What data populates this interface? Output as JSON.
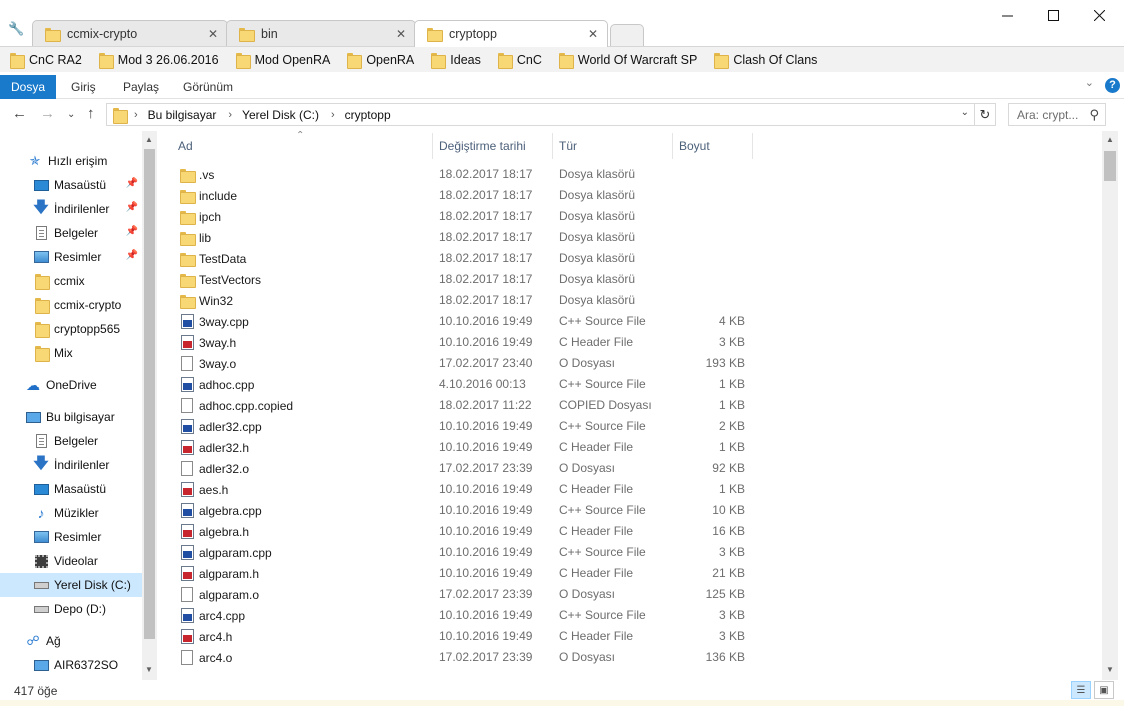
{
  "browser_tabs": [
    {
      "label": "ccmix-crypto",
      "active": false
    },
    {
      "label": "bin",
      "active": false
    },
    {
      "label": "cryptopp",
      "active": true
    }
  ],
  "bookmarks": [
    "CnC RA2",
    "Mod 3 26.06.2016",
    "Mod OpenRA",
    "OpenRA",
    "Ideas",
    "CnC",
    "World Of Warcraft SP",
    "Clash Of Clans"
  ],
  "ribbon": {
    "file": "Dosya",
    "tabs": [
      "Giriş",
      "Paylaş",
      "Görünüm"
    ]
  },
  "address": {
    "crumbs": [
      "Bu bilgisayar",
      "Yerel Disk (C:)",
      "cryptopp"
    ],
    "search_placeholder": "Ara: crypt..."
  },
  "sidebar": [
    {
      "label": "Hızlı erişim",
      "icon": "star-icon",
      "header": true
    },
    {
      "label": "Masaüstü",
      "icon": "desktop-icon",
      "pinned": true
    },
    {
      "label": "İndirilenler",
      "icon": "download-icon",
      "pinned": true
    },
    {
      "label": "Belgeler",
      "icon": "documents-icon",
      "pinned": true
    },
    {
      "label": "Resimler",
      "icon": "pictures-icon",
      "pinned": true
    },
    {
      "label": "ccmix",
      "icon": "folder-icon"
    },
    {
      "label": "ccmix-crypto",
      "icon": "folder-icon"
    },
    {
      "label": "cryptopp565",
      "icon": "folder-icon"
    },
    {
      "label": "Mix",
      "icon": "folder-icon"
    },
    {
      "label": "OneDrive",
      "icon": "cloud-icon",
      "header": true
    },
    {
      "label": "Bu bilgisayar",
      "icon": "computer-icon",
      "header": true
    },
    {
      "label": "Belgeler",
      "icon": "documents-icon"
    },
    {
      "label": "İndirilenler",
      "icon": "download-icon"
    },
    {
      "label": "Masaüstü",
      "icon": "desktop-icon"
    },
    {
      "label": "Müzikler",
      "icon": "music-icon"
    },
    {
      "label": "Resimler",
      "icon": "pictures-icon"
    },
    {
      "label": "Videolar",
      "icon": "video-icon"
    },
    {
      "label": "Yerel Disk (C:)",
      "icon": "drive-icon",
      "selected": true
    },
    {
      "label": "Depo (D:)",
      "icon": "drive-icon"
    },
    {
      "label": "Ağ",
      "icon": "network-icon",
      "header": true
    },
    {
      "label": "AIR6372SO",
      "icon": "computer-icon"
    }
  ],
  "columns": {
    "name": "Ad",
    "date": "Değiştirme tarihi",
    "type": "Tür",
    "size": "Boyut"
  },
  "files": [
    {
      "name": ".vs",
      "date": "18.02.2017 18:17",
      "type": "Dosya klasörü",
      "size": "",
      "icon": "folder"
    },
    {
      "name": "include",
      "date": "18.02.2017 18:17",
      "type": "Dosya klasörü",
      "size": "",
      "icon": "folder"
    },
    {
      "name": "ipch",
      "date": "18.02.2017 18:17",
      "type": "Dosya klasörü",
      "size": "",
      "icon": "folder"
    },
    {
      "name": "lib",
      "date": "18.02.2017 18:17",
      "type": "Dosya klasörü",
      "size": "",
      "icon": "folder"
    },
    {
      "name": "TestData",
      "date": "18.02.2017 18:17",
      "type": "Dosya klasörü",
      "size": "",
      "icon": "folder"
    },
    {
      "name": "TestVectors",
      "date": "18.02.2017 18:17",
      "type": "Dosya klasörü",
      "size": "",
      "icon": "folder"
    },
    {
      "name": "Win32",
      "date": "18.02.2017 18:17",
      "type": "Dosya klasörü",
      "size": "",
      "icon": "folder"
    },
    {
      "name": "3way.cpp",
      "date": "10.10.2016 19:49",
      "type": "C++ Source File",
      "size": "4 KB",
      "icon": "cpp"
    },
    {
      "name": "3way.h",
      "date": "10.10.2016 19:49",
      "type": "C Header File",
      "size": "3 KB",
      "icon": "h"
    },
    {
      "name": "3way.o",
      "date": "17.02.2017 23:40",
      "type": "O Dosyası",
      "size": "193 KB",
      "icon": "blank"
    },
    {
      "name": "adhoc.cpp",
      "date": "4.10.2016 00:13",
      "type": "C++ Source File",
      "size": "1 KB",
      "icon": "cpp"
    },
    {
      "name": "adhoc.cpp.copied",
      "date": "18.02.2017 11:22",
      "type": "COPIED Dosyası",
      "size": "1 KB",
      "icon": "blank"
    },
    {
      "name": "adler32.cpp",
      "date": "10.10.2016 19:49",
      "type": "C++ Source File",
      "size": "2 KB",
      "icon": "cpp"
    },
    {
      "name": "adler32.h",
      "date": "10.10.2016 19:49",
      "type": "C Header File",
      "size": "1 KB",
      "icon": "h"
    },
    {
      "name": "adler32.o",
      "date": "17.02.2017 23:39",
      "type": "O Dosyası",
      "size": "92 KB",
      "icon": "blank"
    },
    {
      "name": "aes.h",
      "date": "10.10.2016 19:49",
      "type": "C Header File",
      "size": "1 KB",
      "icon": "h"
    },
    {
      "name": "algebra.cpp",
      "date": "10.10.2016 19:49",
      "type": "C++ Source File",
      "size": "10 KB",
      "icon": "cpp"
    },
    {
      "name": "algebra.h",
      "date": "10.10.2016 19:49",
      "type": "C Header File",
      "size": "16 KB",
      "icon": "h"
    },
    {
      "name": "algparam.cpp",
      "date": "10.10.2016 19:49",
      "type": "C++ Source File",
      "size": "3 KB",
      "icon": "cpp"
    },
    {
      "name": "algparam.h",
      "date": "10.10.2016 19:49",
      "type": "C Header File",
      "size": "21 KB",
      "icon": "h"
    },
    {
      "name": "algparam.o",
      "date": "17.02.2017 23:39",
      "type": "O Dosyası",
      "size": "125 KB",
      "icon": "blank"
    },
    {
      "name": "arc4.cpp",
      "date": "10.10.2016 19:49",
      "type": "C++ Source File",
      "size": "3 KB",
      "icon": "cpp"
    },
    {
      "name": "arc4.h",
      "date": "10.10.2016 19:49",
      "type": "C Header File",
      "size": "3 KB",
      "icon": "h"
    },
    {
      "name": "arc4.o",
      "date": "17.02.2017 23:39",
      "type": "O Dosyası",
      "size": "136 KB",
      "icon": "blank"
    }
  ],
  "status": {
    "count": "417 öğe"
  }
}
